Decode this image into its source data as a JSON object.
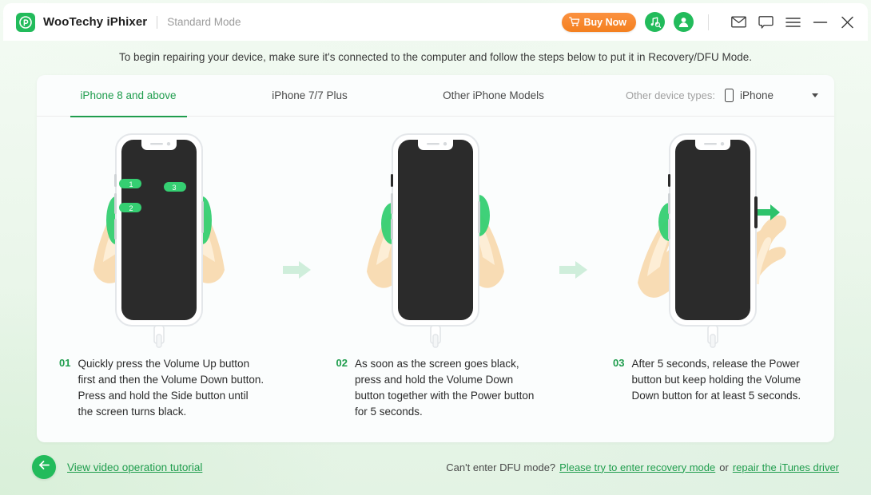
{
  "titlebar": {
    "logo_icon": "wootechy-logo-icon",
    "app_title": "WooTechy iPhixer",
    "mode_label": "Standard Mode",
    "buy_now_label": "Buy Now",
    "buy_now_icon": "shopping-cart-icon",
    "accent_orange": "#f4801f",
    "accent_green": "#22bb5b",
    "icons": [
      {
        "name": "itunes-search-icon"
      },
      {
        "name": "account-icon"
      },
      {
        "name": "mail-icon"
      },
      {
        "name": "feedback-chat-icon"
      },
      {
        "name": "hamburger-menu-icon"
      },
      {
        "name": "minimize-icon"
      },
      {
        "name": "close-icon"
      }
    ]
  },
  "banner": {
    "text": "To begin repairing your device, make sure it's connected to the computer and follow the steps below to put it in Recovery/DFU Mode."
  },
  "tabs": [
    {
      "label": "iPhone 8 and above",
      "active": true
    },
    {
      "label": "iPhone 7/7 Plus",
      "active": false
    },
    {
      "label": "Other iPhone Models",
      "active": false
    }
  ],
  "device_picker": {
    "label": "Other device types:",
    "icon": "phone-outline-icon",
    "value": "iPhone",
    "caret_icon": "chevron-down-icon"
  },
  "steps": [
    {
      "number": "01",
      "text": "Quickly press the Volume Up button first and then the Volume Down button. Press and hold the Side button until the screen turns black.",
      "illustration": "iphone-press-volume-up-down-side-illustration"
    },
    {
      "number": "02",
      "text": "As soon as the screen goes black, press and hold the Volume Down button together with the Power button for 5 seconds.",
      "illustration": "iphone-hold-volume-down-power-illustration"
    },
    {
      "number": "03",
      "text": "After 5 seconds, release the Power button but keep holding the Volume Down button for at least 5 seconds.",
      "illustration": "iphone-release-power-hold-volume-down-illustration"
    }
  ],
  "step_separator_icon": "arrow-right-icon",
  "footer": {
    "back_icon": "arrow-left-icon",
    "tutorial_link": "View video operation tutorial",
    "help_prefix": "Can't enter DFU mode?",
    "recovery_link": "Please try to enter recovery mode",
    "help_conjunction": "or",
    "itunes_link": "repair the iTunes driver"
  }
}
